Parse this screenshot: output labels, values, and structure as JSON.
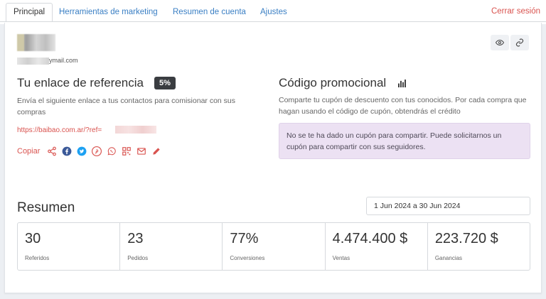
{
  "tabs": [
    {
      "label": "Principal",
      "active": true
    },
    {
      "label": "Herramientas de marketing",
      "active": false
    },
    {
      "label": "Resumen de cuenta",
      "active": false
    },
    {
      "label": "Ajustes",
      "active": false
    }
  ],
  "logout_label": "Cerrar sesión",
  "profile": {
    "email_suffix": "ymail.com"
  },
  "referral": {
    "title": "Tu enlace de referencia",
    "badge": "5%",
    "description": "Envía el siguiente enlace a tus contactos para comisionar con sus compras",
    "link": "https://baibao.com.ar/?ref=",
    "copy_label": "Copiar",
    "share_icons": [
      "share-icon",
      "facebook-icon",
      "twitter-icon",
      "pinterest-icon",
      "whatsapp-icon",
      "qr-code-icon",
      "email-icon",
      "edit-icon"
    ]
  },
  "promo": {
    "title": "Código promocional",
    "description": "Comparte tu cupón de descuento con tus conocidos. Por cada compra que hagan usando el código de cupón, obtendrás el crédito",
    "alert": "No se te ha dado un cupón para compartir. Puede solicitarnos un cupón para compartir con sus seguidores."
  },
  "summary": {
    "title": "Resumen",
    "date_range": "1 Jun 2024 a 30 Jun 2024",
    "stats": [
      {
        "value": "30",
        "label": "Referidos"
      },
      {
        "value": "23",
        "label": "Pedidos"
      },
      {
        "value": "77%",
        "label": "Conversiones"
      },
      {
        "value": "4.474.400 $",
        "label": "Ventas"
      },
      {
        "value": "223.720 $",
        "label": "Ganancias"
      }
    ]
  },
  "colors": {
    "accent_link": "#3a7fc4",
    "danger": "#d9534f",
    "alert_bg": "#ece1f3"
  }
}
